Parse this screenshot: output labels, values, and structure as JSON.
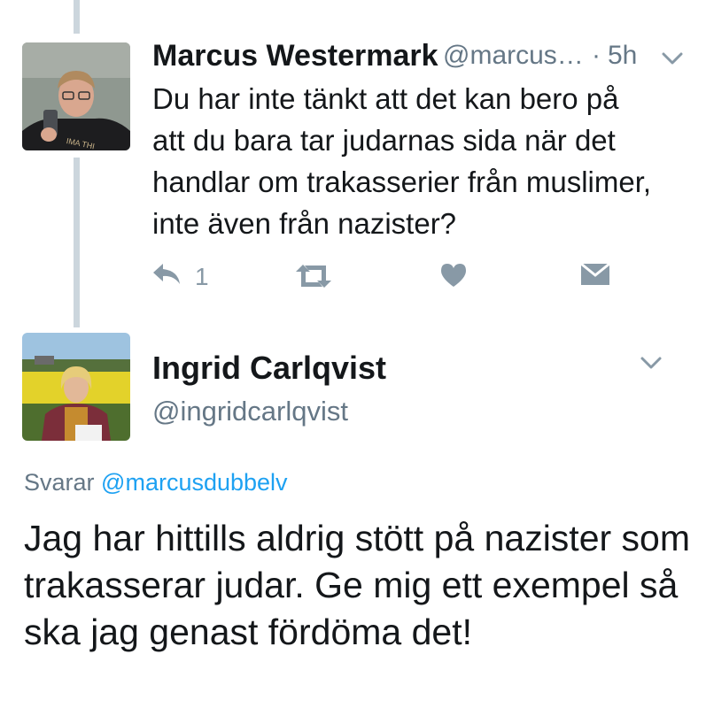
{
  "tweet1": {
    "author_name": "Marcus Westermark",
    "author_handle": "@marcus…",
    "time_sep": "·",
    "time": "5h",
    "text": "Du har inte tänkt att det kan bero på att du bara tar judarnas sida när det handlar om trakasserier från muslimer, inte även från nazister?",
    "actions": {
      "reply_count": "1",
      "reply_icon": "reply-icon",
      "retweet_icon": "retweet-icon",
      "like_icon": "heart-icon",
      "dm_icon": "envelope-icon"
    },
    "shirt_text": "IMA THI"
  },
  "tweet2": {
    "author_name": "Ingrid Carlqvist",
    "author_handle": "@ingridcarlqvist",
    "replying_prefix": "Svarar",
    "replying_to": "@marcusdubbelv",
    "text": "Jag har hittills aldrig stött på nazister som trakasserar judar. Ge mig ett exempel så ska jag genast fördöma det!"
  },
  "colors": {
    "text": "#14171a",
    "secondary": "#657786",
    "icon": "#8899a6",
    "link": "#1da1f2",
    "thread_line": "#ccd6dd"
  }
}
